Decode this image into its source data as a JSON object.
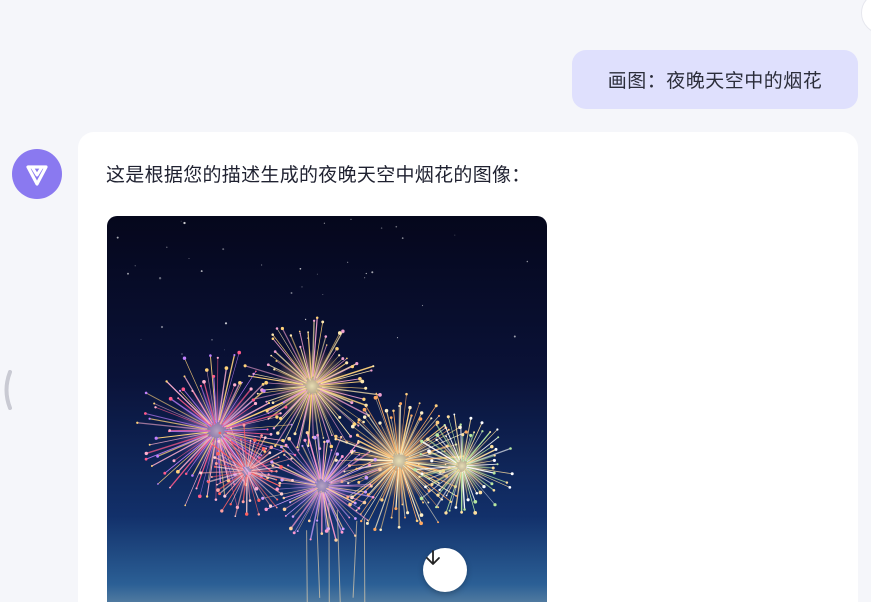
{
  "chat": {
    "user_message": "画图：夜晚天空中的烟花",
    "assistant_message": "这是根据您的描述生成的夜晚天空中烟花的图像："
  },
  "icons": {
    "avatar": "assistant-logo-icon",
    "download": "download-arrow-icon",
    "sidebar_toggle": "sidebar-handle-icon"
  },
  "colors": {
    "accent": "#8a79f0",
    "user_bubble": "#dfe0fd",
    "background": "#f5f6fa"
  }
}
